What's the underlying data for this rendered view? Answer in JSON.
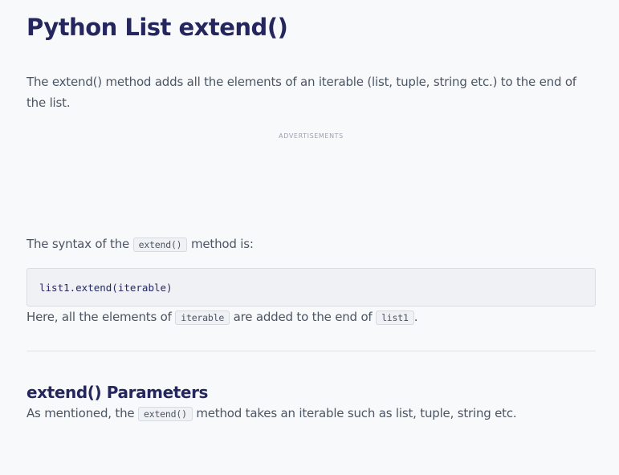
{
  "article": {
    "title": "Python List extend()",
    "intro": "The extend() method adds all the elements of an iterable (list, tuple, string etc.) to the end of the list.",
    "ad_label": "ADVERTISEMENTS",
    "syntax": {
      "prefix": "The syntax of the ",
      "code": "extend()",
      "suffix": " method is:"
    },
    "code_block": "list1.extend(iterable)",
    "explain": {
      "prefix": "Here, all the elements of ",
      "code1": "iterable",
      "middle": " are added to the end of ",
      "code2": "list1",
      "suffix": "."
    },
    "params_section": {
      "title": "extend() Parameters",
      "prefix": "As mentioned, the ",
      "code": "extend()",
      "suffix": " method takes an iterable such as list, tuple, string etc."
    }
  },
  "colors": {
    "title": "#25265e",
    "body_text": "#4b5563",
    "background": "#f8f9fb",
    "code_bg": "#eff1f4"
  }
}
